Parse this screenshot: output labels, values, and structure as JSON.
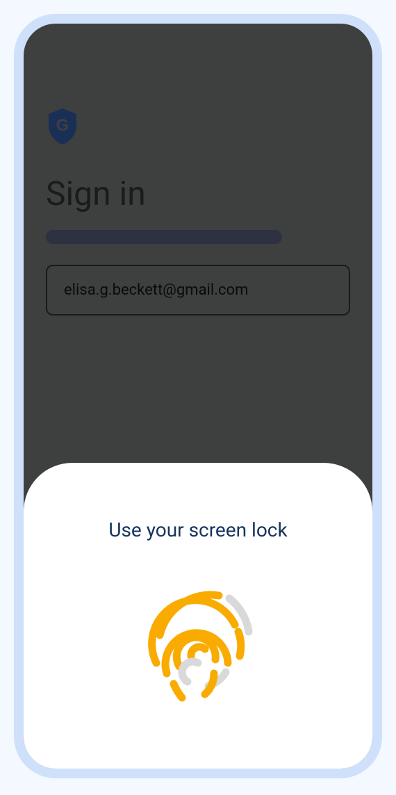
{
  "signin": {
    "title": "Sign in",
    "email": "elisa.g.beckett@gmail.com"
  },
  "sheet": {
    "title": "Use your screen lock"
  },
  "icons": {
    "shield": "google-shield-icon",
    "fingerprint": "fingerprint-icon"
  },
  "colors": {
    "accent": "#f9ab00",
    "sheet_title": "#16335f",
    "frame": "#cfe0fb",
    "dimmed_bg": "#3e403f"
  }
}
